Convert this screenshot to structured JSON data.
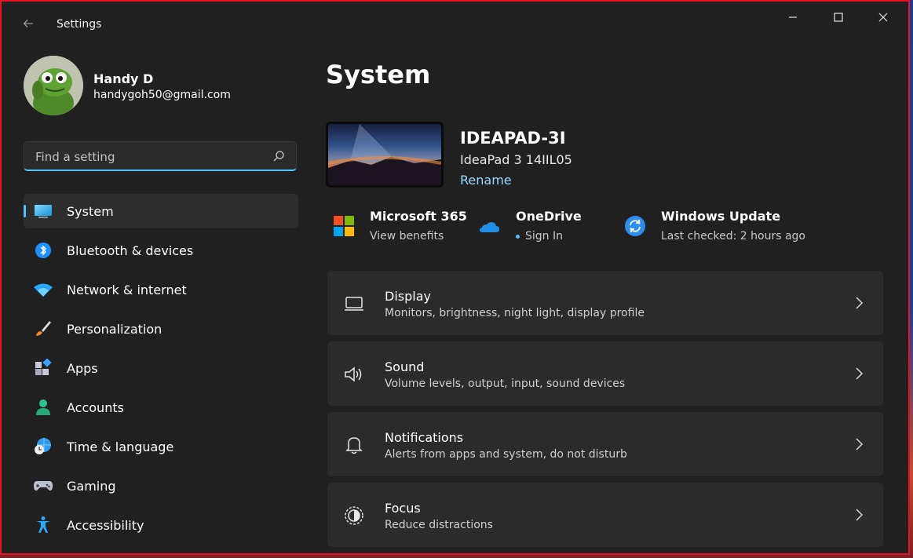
{
  "window": {
    "title": "Settings"
  },
  "profile": {
    "name": "Handy D",
    "email": "handygoh50@gmail.com"
  },
  "search": {
    "placeholder": "Find a setting"
  },
  "nav": {
    "items": [
      {
        "label": "System",
        "icon": "system-icon",
        "active": true
      },
      {
        "label": "Bluetooth & devices",
        "icon": "bluetooth-icon"
      },
      {
        "label": "Network & internet",
        "icon": "wifi-icon"
      },
      {
        "label": "Personalization",
        "icon": "brush-icon"
      },
      {
        "label": "Apps",
        "icon": "apps-icon"
      },
      {
        "label": "Accounts",
        "icon": "accounts-icon"
      },
      {
        "label": "Time & language",
        "icon": "globe-clock-icon"
      },
      {
        "label": "Gaming",
        "icon": "gamepad-icon"
      },
      {
        "label": "Accessibility",
        "icon": "accessibility-icon"
      }
    ]
  },
  "main": {
    "title": "System",
    "device": {
      "name": "IDEAPAD-3I",
      "model": "IdeaPad 3 14IIL05",
      "rename_label": "Rename"
    },
    "quick": [
      {
        "title": "Microsoft 365",
        "subtitle": "View benefits",
        "icon": "microsoft-365-icon"
      },
      {
        "title": "OneDrive",
        "subtitle": "Sign In",
        "icon": "onedrive-icon"
      },
      {
        "title": "Windows Update",
        "subtitle": "Last checked: 2 hours ago",
        "icon": "windows-update-icon"
      }
    ],
    "cards": [
      {
        "title": "Display",
        "subtitle": "Monitors, brightness, night light, display profile",
        "icon": "display-icon"
      },
      {
        "title": "Sound",
        "subtitle": "Volume levels, output, input, sound devices",
        "icon": "speaker-icon"
      },
      {
        "title": "Notifications",
        "subtitle": "Alerts from apps and system, do not disturb",
        "icon": "bell-icon"
      },
      {
        "title": "Focus",
        "subtitle": "Reduce distractions",
        "icon": "focus-icon"
      }
    ]
  },
  "colors": {
    "accent": "#4cc2ff",
    "link": "#99d9ff",
    "window_bg": "#202020",
    "card_bg": "#2b2b2b",
    "window_border": "#e81123"
  }
}
